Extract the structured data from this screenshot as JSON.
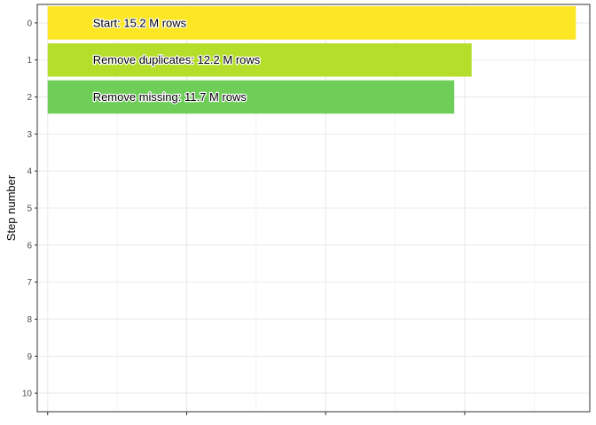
{
  "chart_data": {
    "type": "bar",
    "orientation": "horizontal",
    "ylabel": "Step number",
    "xlabel": "",
    "categories": [
      "0",
      "1",
      "2",
      "3",
      "4",
      "5",
      "6",
      "7",
      "8",
      "9",
      "10"
    ],
    "bars": [
      {
        "step": 0,
        "value": 15.2,
        "label": "Start:  15.2 M rows",
        "color": "#FDE725"
      },
      {
        "step": 1,
        "value": 12.2,
        "label": "Remove duplicates:  12.2 M rows",
        "color": "#B5DE2B"
      },
      {
        "step": 2,
        "value": 11.7,
        "label": "Remove missing:  11.7 M rows",
        "color": "#6ECE58"
      }
    ],
    "xlim": [
      0,
      15.9
    ],
    "ylim": [
      -0.5,
      10.5
    ],
    "grid": true,
    "legend": "none",
    "colors": {
      "grid": "#ebebeb",
      "border": "#333333"
    }
  }
}
